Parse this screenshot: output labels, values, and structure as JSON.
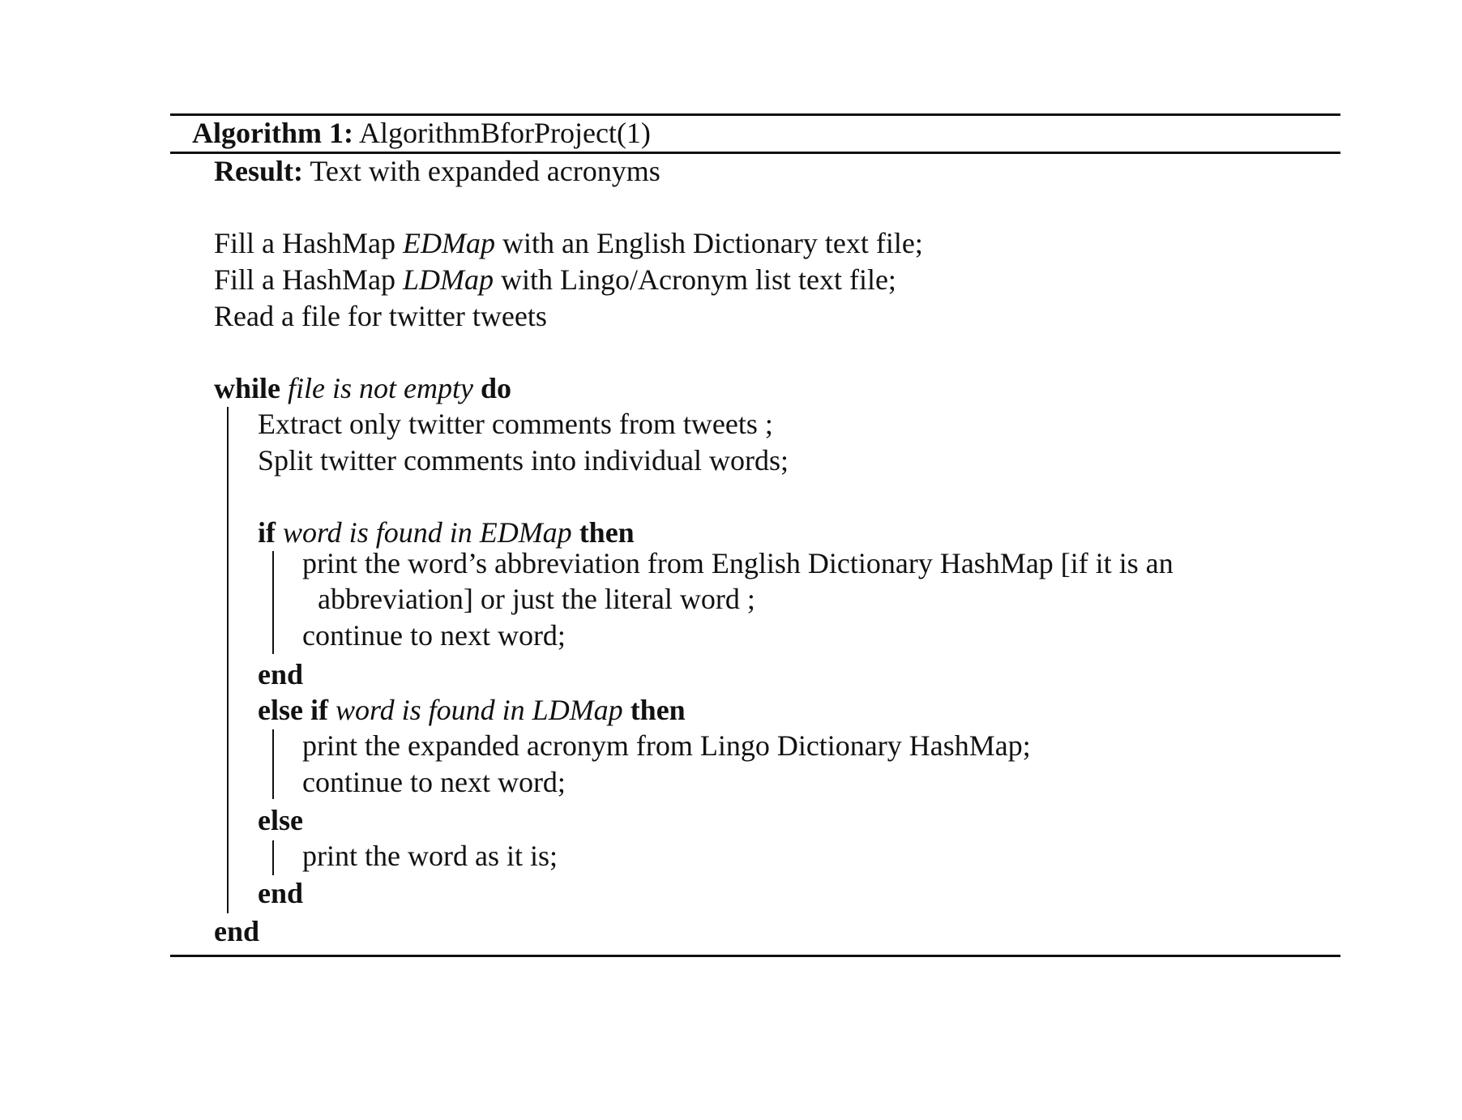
{
  "algorithm": {
    "label": "Algorithm 1:",
    "name": "AlgorithmBforProject(1)",
    "result_label": "Result:",
    "result_text": "Text with expanded acronyms",
    "setup": [
      {
        "prefix": "Fill a HashMap ",
        "var": "EDMap",
        "suffix": " with an English Dictionary text file;"
      },
      {
        "prefix": "Fill a HashMap ",
        "var": "LDMap",
        "suffix": " with Lingo/Acronym list text file;"
      },
      {
        "text": "Read a file for twitter tweets"
      }
    ],
    "while": {
      "keyword": "while",
      "condition": "file is not empty",
      "do_keyword": "do",
      "body": [
        "Extract only twitter comments from tweets ;",
        "Split twitter comments into individual words;"
      ],
      "if_block": {
        "keyword": "if",
        "condition": "word is found in EDMap",
        "then_keyword": "then",
        "body_line1": "print the word’s abbreviation from English Dictionary HashMap [if it is an",
        "body_line1_cont": "abbreviation] or just the literal word ;",
        "body_line2": "continue to next word;",
        "end_keyword": "end"
      },
      "elseif_block": {
        "keyword": "else if",
        "condition": "word is found in LDMap",
        "then_keyword": "then",
        "body_line1": "print the expanded acronym from Lingo Dictionary HashMap;",
        "body_line2": "continue to next word;"
      },
      "else_block": {
        "keyword": "else",
        "body_line1": "print the word as it is;",
        "end_keyword": "end"
      },
      "end_keyword": "end"
    }
  }
}
